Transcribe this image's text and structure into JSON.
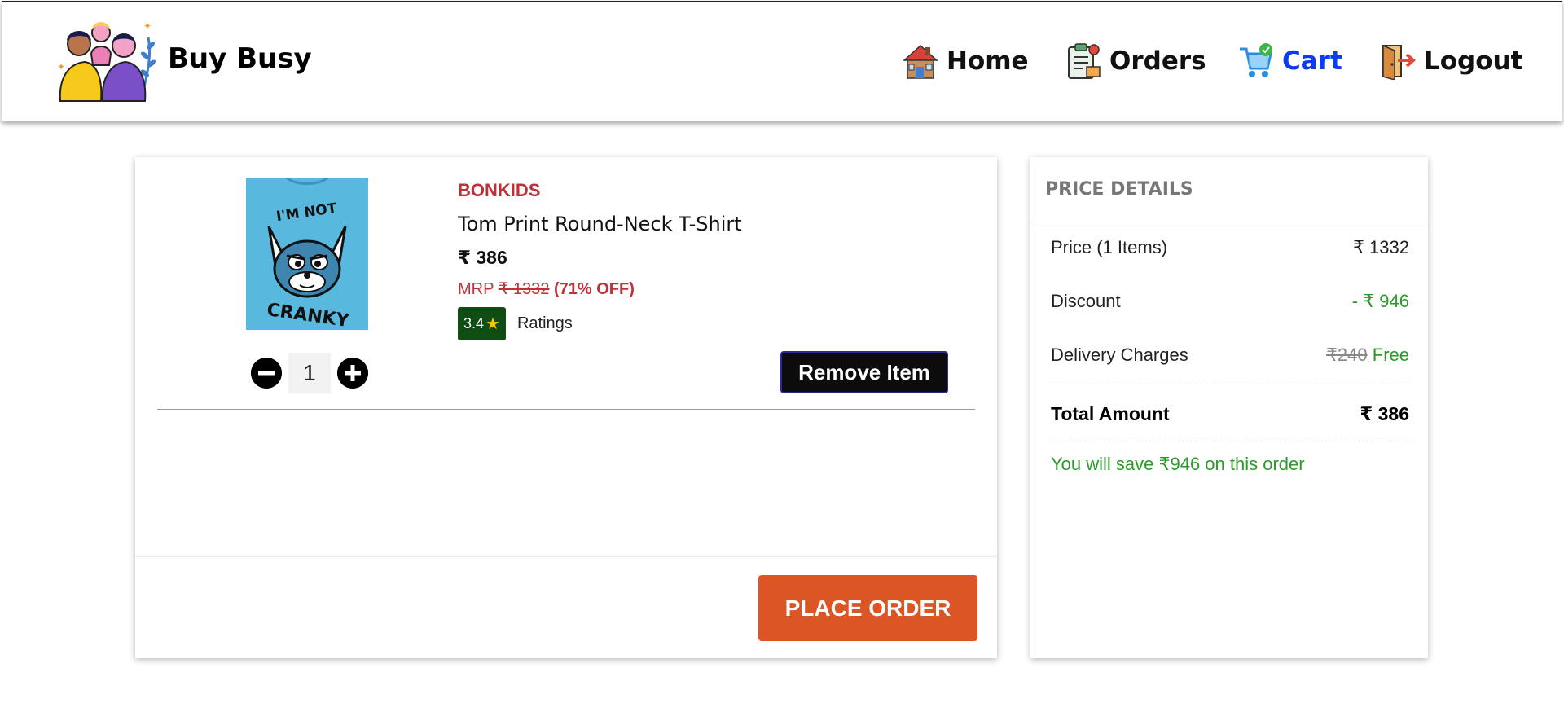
{
  "header": {
    "brand": "Buy Busy",
    "nav": [
      {
        "label": "Home",
        "icon": "house-icon"
      },
      {
        "label": "Orders",
        "icon": "clipboard-icon"
      },
      {
        "label": "Cart",
        "icon": "cart-icon",
        "active": true
      },
      {
        "label": "Logout",
        "icon": "door-exit-icon"
      }
    ]
  },
  "cart": {
    "items": [
      {
        "brand": "BONKIDS",
        "title": "Tom Print Round-Neck T-Shirt",
        "price": "₹ 386",
        "mrp_label": "MRP",
        "mrp": "₹ 1332",
        "discount": "(71% OFF)",
        "rating": "3.4",
        "ratings_label": "Ratings",
        "quantity": "1",
        "image_text_top": "I'M NOT",
        "image_text_bottom": "CRANKY",
        "remove_label": "Remove Item"
      }
    ],
    "place_order_label": "PLACE ORDER"
  },
  "price_details": {
    "heading": "PRICE DETAILS",
    "price_label": "Price (1 Items)",
    "price_value": "₹ 1332",
    "discount_label": "Discount",
    "discount_value": "- ₹ 946",
    "delivery_label": "Delivery Charges",
    "delivery_original": "₹240",
    "delivery_value": "Free",
    "total_label": "Total Amount",
    "total_value": "₹ 386",
    "savings_text": "You will save ₹946 on this order"
  },
  "colors": {
    "accent_nav_active": "#0a3cf0",
    "place_order": "#db5624",
    "brand_red": "#c0303a",
    "savings_green": "#2b9a2b",
    "rating_badge": "#0f4d14"
  }
}
